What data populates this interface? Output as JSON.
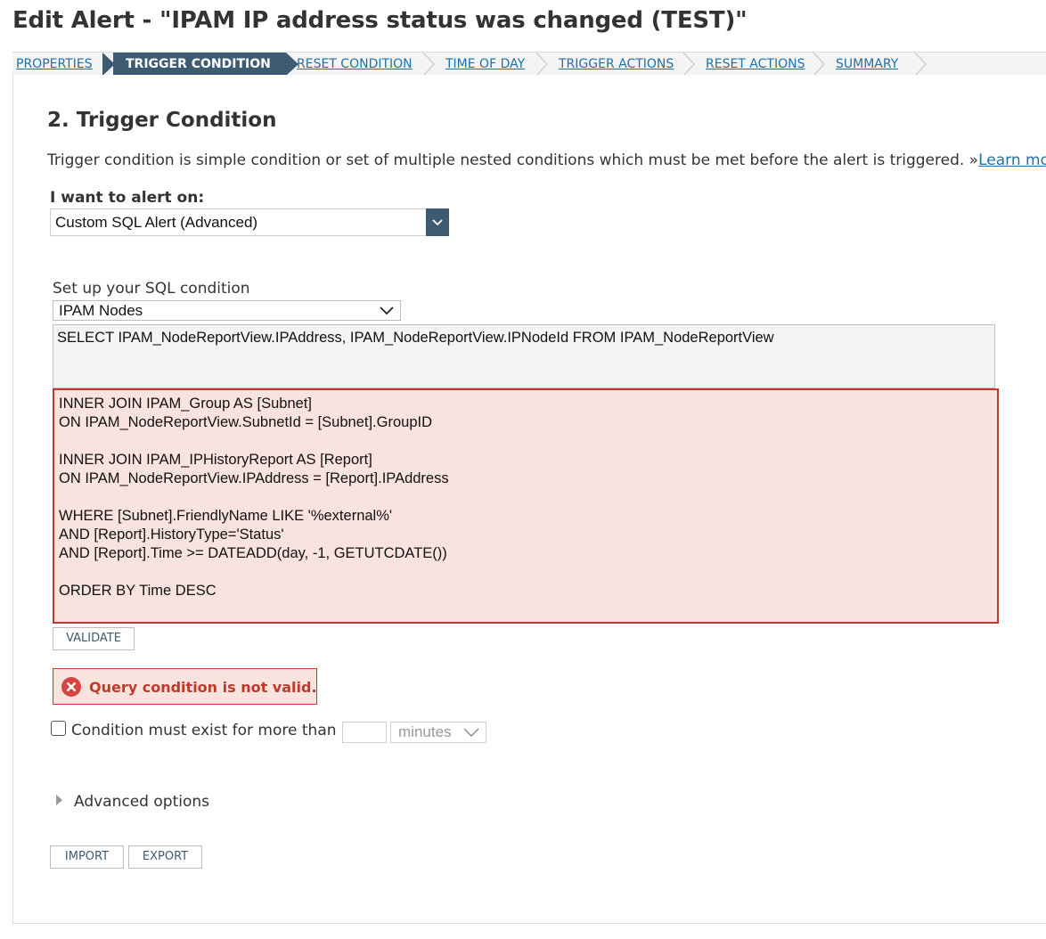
{
  "page_title": "Edit Alert - \"IPAM IP address status was changed (TEST)\"",
  "steps": [
    {
      "label": "PROPERTIES",
      "active": false
    },
    {
      "label": "TRIGGER CONDITION",
      "active": true
    },
    {
      "label": "RESET CONDITION",
      "active": false
    },
    {
      "label": "TIME OF DAY",
      "active": false
    },
    {
      "label": "TRIGGER ACTIONS",
      "active": false
    },
    {
      "label": "RESET ACTIONS",
      "active": false
    },
    {
      "label": "SUMMARY",
      "active": false
    }
  ],
  "section": {
    "heading": "2. Trigger Condition",
    "description": "Trigger condition is simple condition or set of multiple nested conditions which must be met before the alert is triggered. »",
    "learn_more": "Learn more"
  },
  "alert_on": {
    "label": "I want to alert on:",
    "value": "Custom SQL Alert (Advanced)"
  },
  "sql": {
    "label": "Set up your SQL condition",
    "source_value": "IPAM Nodes",
    "select_statement": "SELECT IPAM_NodeReportView.IPAddress, IPAM_NodeReportView.IPNodeId FROM IPAM_NodeReportView",
    "condition_lines": [
      "INNER JOIN IPAM_Group AS [Subnet]",
      "ON IPAM_NodeReportView.SubnetId = [Subnet].GroupID",
      "",
      "INNER JOIN IPAM_IPHistoryReport AS [Report]",
      "ON IPAM_NodeReportView.IPAddress = [Report].IPAddress",
      "",
      "WHERE [Subnet].FriendlyName LIKE '%external%'",
      "AND [Report].HistoryType='Status'",
      "AND [Report].Time >= DATEADD(day, -1, GETUTCDATE())",
      "",
      "ORDER BY  Time DESC"
    ],
    "validate_label": "VALIDATE",
    "error_message": "Query condition is not valid."
  },
  "duration": {
    "label": "Condition must exist for more than",
    "value": "",
    "unit": "minutes",
    "checked": false
  },
  "advanced_label": "Advanced options",
  "buttons": {
    "import_label": "IMPORT",
    "export_label": "EXPORT"
  },
  "colors": {
    "accent": "#3e5b74",
    "link": "#1f6fa8",
    "error": "#c0392b",
    "error_bg": "#f9e3df"
  }
}
